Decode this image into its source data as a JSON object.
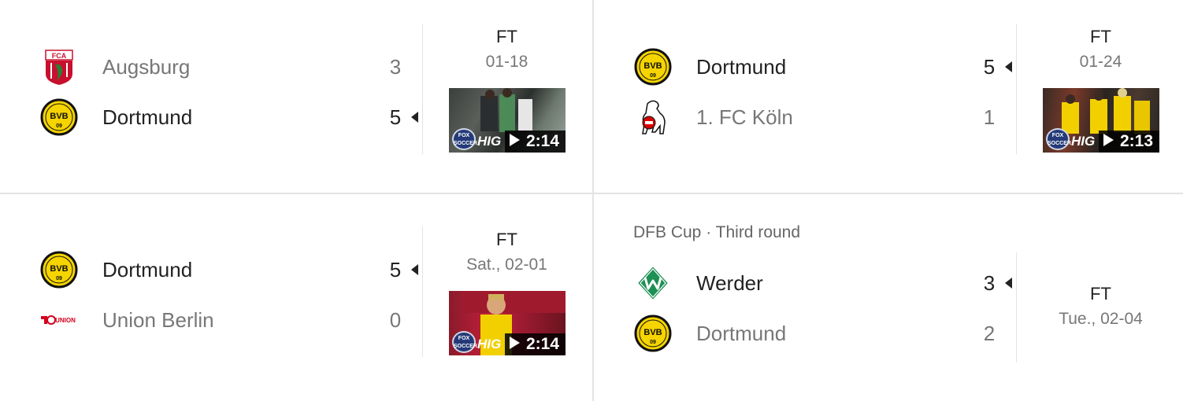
{
  "matches": [
    {
      "home": {
        "name": "Augsburg",
        "score": "3",
        "logo": "augsburg-logo"
      },
      "away": {
        "name": "Dortmund",
        "score": "5",
        "logo": "dortmund-logo"
      },
      "status": "FT",
      "date": "01-18",
      "highlight": {
        "duration": "2:14",
        "label": "HIG"
      }
    },
    {
      "home": {
        "name": "Dortmund",
        "score": "5",
        "logo": "dortmund-logo"
      },
      "away": {
        "name": "1. FC Köln",
        "score": "1",
        "logo": "koln-logo"
      },
      "status": "FT",
      "date": "01-24",
      "highlight": {
        "duration": "2:13",
        "label": "HIG"
      }
    },
    {
      "home": {
        "name": "Dortmund",
        "score": "5",
        "logo": "dortmund-logo"
      },
      "away": {
        "name": "Union Berlin",
        "score": "0",
        "logo": "union-berlin-logo"
      },
      "status": "FT",
      "date": "Sat., 02-01",
      "highlight": {
        "duration": "2:14",
        "label": "HIG"
      }
    },
    {
      "competition": "DFB Cup · Third round",
      "home": {
        "name": "Werder",
        "score": "3",
        "logo": "werder-logo"
      },
      "away": {
        "name": "Dortmund",
        "score": "2",
        "logo": "dortmund-logo"
      },
      "status": "FT",
      "date": "Tue., 02-04"
    }
  ],
  "colors": {
    "bvb_yellow": "#f5d400",
    "divider": "#e3e3e3",
    "text_primary": "#222222",
    "text_secondary": "#777777"
  }
}
